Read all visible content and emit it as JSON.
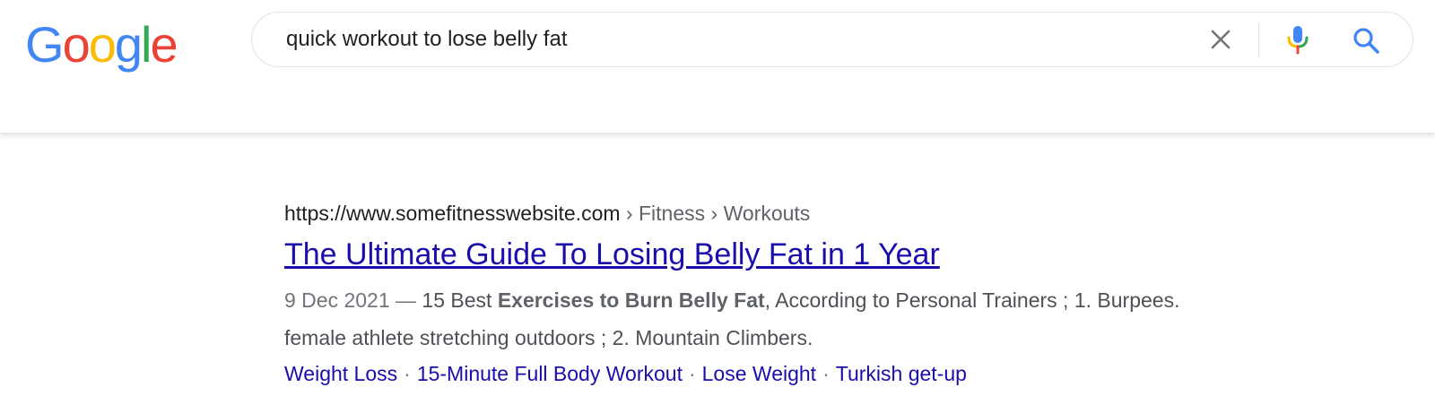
{
  "logo": {
    "letters": [
      "G",
      "o",
      "o",
      "g",
      "l",
      "e"
    ],
    "colors": [
      "#4285F4",
      "#EA4335",
      "#FBBC05",
      "#4285F4",
      "#34A853",
      "#EA4335"
    ]
  },
  "search": {
    "query": "quick workout to lose belly fat",
    "clear_icon": "close-icon",
    "mic_icon": "microphone-icon",
    "search_icon": "search-icon"
  },
  "result": {
    "url": "https://www.somefitnesswebsite.com",
    "breadcrumbs": [
      "Fitness",
      "Workouts"
    ],
    "breadcrumb_separator": "›",
    "title": "The Ultimate Guide To Losing Belly Fat in 1 Year",
    "snippet": {
      "date": "9 Dec 2021",
      "dash": " — ",
      "text_before": "15 Best ",
      "bold": "Exercises to Burn Belly Fat",
      "text_after": ", According to Personal Trainers ; 1. Burpees. female athlete stretching outdoors ; 2. Mountain Climbers."
    },
    "sitelinks": [
      "Weight Loss",
      "15-Minute Full Body Workout",
      "Lose Weight",
      "Turkish get-up"
    ],
    "sitelink_separator": "·"
  },
  "colors": {
    "link": "#1a0dab",
    "text": "#202124",
    "secondary": "#5f6368",
    "google_blue": "#4285F4"
  }
}
